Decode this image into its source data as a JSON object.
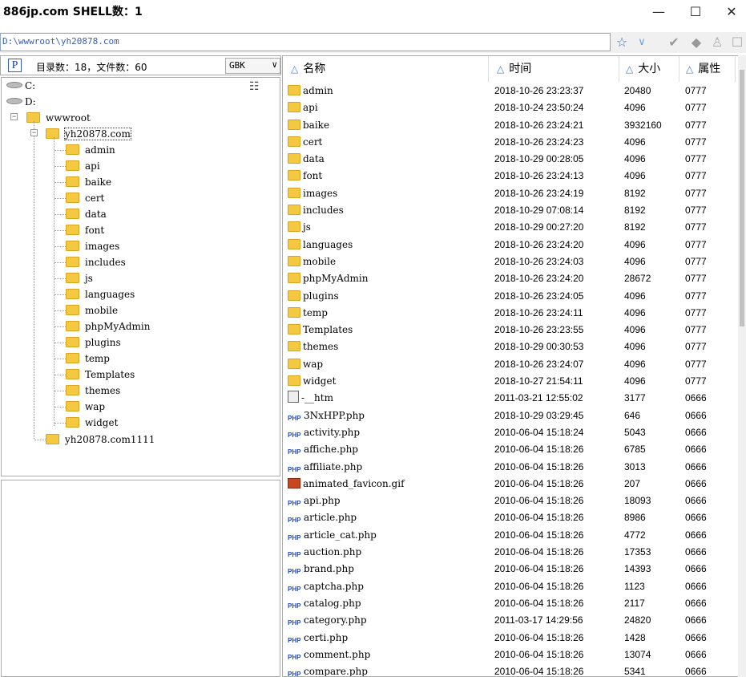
{
  "window": {
    "title": "886jp.com SHELL数：1",
    "minimize": "—",
    "maximize": "☐",
    "close": "✕"
  },
  "address": {
    "path": "D:\\wwwroot\\yh20878.com"
  },
  "info": {
    "p_label": "P",
    "summary": "目录数：18，文件数：60",
    "encoding": "GBK"
  },
  "tree": {
    "drives": [
      "C:",
      "D:"
    ],
    "wwwroot": "wwwroot",
    "site": "yh20878.com",
    "site2": "yh20878.com1111",
    "folders": [
      "admin",
      "api",
      "baike",
      "cert",
      "data",
      "font",
      "images",
      "includes",
      "js",
      "languages",
      "mobile",
      "phpMyAdmin",
      "plugins",
      "temp",
      "Templates",
      "themes",
      "wap",
      "widget"
    ]
  },
  "columns": {
    "name": "名称",
    "time": "时间",
    "size": "大小",
    "attr": "属性"
  },
  "files": [
    {
      "name": "admin",
      "time": "2018-10-26 23:23:37",
      "size": "20480",
      "attr": "0777",
      "type": "folder"
    },
    {
      "name": "api",
      "time": "2018-10-24 23:50:24",
      "size": "4096",
      "attr": "0777",
      "type": "folder"
    },
    {
      "name": "baike",
      "time": "2018-10-26 23:24:21",
      "size": "3932160",
      "attr": "0777",
      "type": "folder"
    },
    {
      "name": "cert",
      "time": "2018-10-26 23:24:23",
      "size": "4096",
      "attr": "0777",
      "type": "folder"
    },
    {
      "name": "data",
      "time": "2018-10-29 00:28:05",
      "size": "4096",
      "attr": "0777",
      "type": "folder"
    },
    {
      "name": "font",
      "time": "2018-10-26 23:24:13",
      "size": "4096",
      "attr": "0777",
      "type": "folder"
    },
    {
      "name": "images",
      "time": "2018-10-26 23:24:19",
      "size": "8192",
      "attr": "0777",
      "type": "folder"
    },
    {
      "name": "includes",
      "time": "2018-10-29 07:08:14",
      "size": "8192",
      "attr": "0777",
      "type": "folder"
    },
    {
      "name": "js",
      "time": "2018-10-29 00:27:20",
      "size": "8192",
      "attr": "0777",
      "type": "folder"
    },
    {
      "name": "languages",
      "time": "2018-10-26 23:24:20",
      "size": "4096",
      "attr": "0777",
      "type": "folder"
    },
    {
      "name": "mobile",
      "time": "2018-10-26 23:24:03",
      "size": "4096",
      "attr": "0777",
      "type": "folder"
    },
    {
      "name": "phpMyAdmin",
      "time": "2018-10-26 23:24:20",
      "size": "28672",
      "attr": "0777",
      "type": "folder"
    },
    {
      "name": "plugins",
      "time": "2018-10-26 23:24:05",
      "size": "4096",
      "attr": "0777",
      "type": "folder"
    },
    {
      "name": "temp",
      "time": "2018-10-26 23:24:11",
      "size": "4096",
      "attr": "0777",
      "type": "folder"
    },
    {
      "name": "Templates",
      "time": "2018-10-26 23:23:55",
      "size": "4096",
      "attr": "0777",
      "type": "folder"
    },
    {
      "name": "themes",
      "time": "2018-10-29 00:30:53",
      "size": "4096",
      "attr": "0777",
      "type": "folder"
    },
    {
      "name": "wap",
      "time": "2018-10-26 23:24:07",
      "size": "4096",
      "attr": "0777",
      "type": "folder"
    },
    {
      "name": "widget",
      "time": "2018-10-27 21:54:11",
      "size": "4096",
      "attr": "0777",
      "type": "folder"
    },
    {
      "name": "-__htm",
      "time": "2011-03-21 12:55:02",
      "size": "3177",
      "attr": "0666",
      "type": "file"
    },
    {
      "name": "3NxHPP.php",
      "time": "2018-10-29 03:29:45",
      "size": "646",
      "attr": "0666",
      "type": "php"
    },
    {
      "name": "activity.php",
      "time": "2010-06-04 15:18:24",
      "size": "5043",
      "attr": "0666",
      "type": "php"
    },
    {
      "name": "affiche.php",
      "time": "2010-06-04 15:18:26",
      "size": "6785",
      "attr": "0666",
      "type": "php"
    },
    {
      "name": "affiliate.php",
      "time": "2010-06-04 15:18:26",
      "size": "3013",
      "attr": "0666",
      "type": "php"
    },
    {
      "name": "animated_favicon.gif",
      "time": "2010-06-04 15:18:26",
      "size": "207",
      "attr": "0666",
      "type": "gif"
    },
    {
      "name": "api.php",
      "time": "2010-06-04 15:18:26",
      "size": "18093",
      "attr": "0666",
      "type": "php"
    },
    {
      "name": "article.php",
      "time": "2010-06-04 15:18:26",
      "size": "8986",
      "attr": "0666",
      "type": "php"
    },
    {
      "name": "article_cat.php",
      "time": "2010-06-04 15:18:26",
      "size": "4772",
      "attr": "0666",
      "type": "php"
    },
    {
      "name": "auction.php",
      "time": "2010-06-04 15:18:26",
      "size": "17353",
      "attr": "0666",
      "type": "php"
    },
    {
      "name": "brand.php",
      "time": "2010-06-04 15:18:26",
      "size": "14393",
      "attr": "0666",
      "type": "php"
    },
    {
      "name": "captcha.php",
      "time": "2010-06-04 15:18:26",
      "size": "1123",
      "attr": "0666",
      "type": "php"
    },
    {
      "name": "catalog.php",
      "time": "2010-06-04 15:18:26",
      "size": "2117",
      "attr": "0666",
      "type": "php"
    },
    {
      "name": "category.php",
      "time": "2011-03-17 14:29:56",
      "size": "24820",
      "attr": "0666",
      "type": "php"
    },
    {
      "name": "certi.php",
      "time": "2010-06-04 15:18:26",
      "size": "1428",
      "attr": "0666",
      "type": "php"
    },
    {
      "name": "comment.php",
      "time": "2010-06-04 15:18:26",
      "size": "13074",
      "attr": "0666",
      "type": "php"
    },
    {
      "name": "compare.php",
      "time": "2010-06-04 15:18:26",
      "size": "5341",
      "attr": "0666",
      "type": "php"
    }
  ]
}
